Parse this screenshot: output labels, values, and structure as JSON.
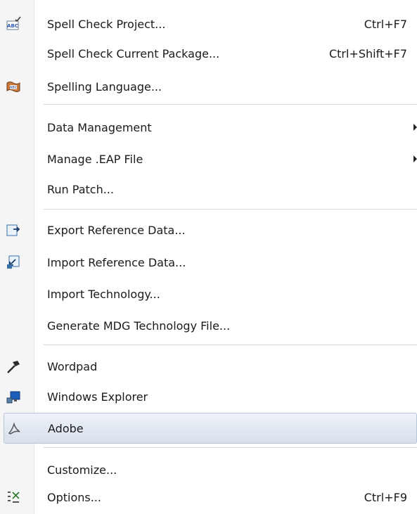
{
  "menu": {
    "items": [
      {
        "label": "Spell Check Project...",
        "shortcut": "Ctrl+F7",
        "icon": "spell-check-icon"
      },
      {
        "label": "Spell Check Current Package...",
        "shortcut": "Ctrl+Shift+F7"
      },
      {
        "label": "Spelling Language...",
        "icon": "spelling-language-icon"
      },
      {
        "label": "Data Management",
        "submenu": true
      },
      {
        "label": "Manage .EAP File",
        "submenu": true
      },
      {
        "label": "Run Patch..."
      },
      {
        "label": "Export Reference Data...",
        "icon": "export-icon"
      },
      {
        "label": "Import Reference Data...",
        "icon": "import-icon"
      },
      {
        "label": "Import Technology..."
      },
      {
        "label": "Generate MDG Technology File..."
      },
      {
        "label": "Wordpad",
        "icon": "hammer-icon"
      },
      {
        "label": "Windows Explorer",
        "icon": "explorer-icon"
      },
      {
        "label": "Adobe",
        "icon": "adobe-icon",
        "highlighted": true
      },
      {
        "label": "Customize..."
      },
      {
        "label": "Options...",
        "shortcut": "Ctrl+F9",
        "icon": "options-icon"
      }
    ]
  },
  "colors": {
    "gutter": "#f5f5f5",
    "separator": "#d9d9d9",
    "highlight_border": "#b7c5d8"
  }
}
